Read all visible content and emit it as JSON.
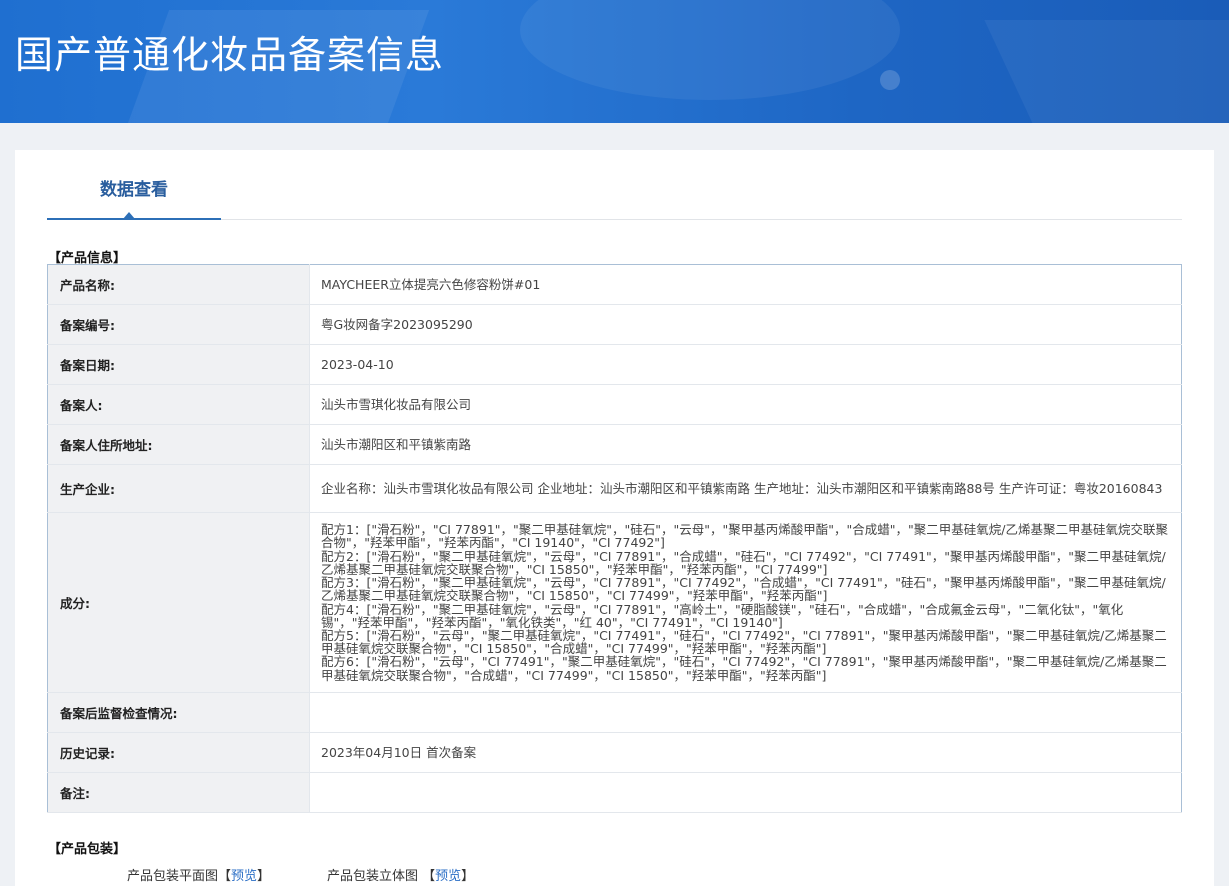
{
  "header": {
    "title": "国产普通化妆品备案信息"
  },
  "tabs": [
    {
      "label": "数据查看",
      "active": true
    }
  ],
  "product_info": {
    "section_title": "【产品信息】",
    "rows": [
      {
        "label": "产品名称:",
        "value": "MAYCHEER立体提亮六色修容粉饼#01"
      },
      {
        "label": "备案编号:",
        "value": "粤G妆网备字2023095290"
      },
      {
        "label": "备案日期:",
        "value": "2023-04-10"
      },
      {
        "label": "备案人:",
        "value": "汕头市雪琪化妆品有限公司"
      },
      {
        "label": "备案人住所地址:",
        "value": "汕头市潮阳区和平镇紫南路"
      },
      {
        "label": "生产企业:",
        "value": "企业名称：汕头市雪琪化妆品有限公司 企业地址：汕头市潮阳区和平镇紫南路 生产地址：汕头市潮阳区和平镇紫南路88号 生产许可证：粤妆20160843"
      },
      {
        "label": "成分:",
        "formulas": [
          "配方1：[\"滑石粉\"，\"CI 77891\"，\"聚二甲基硅氧烷\"，\"硅石\"，\"云母\"，\"聚甲基丙烯酸甲酯\"，\"合成蜡\"，\"聚二甲基硅氧烷/乙烯基聚二甲基硅氧烷交联聚合物\"，\"羟苯甲酯\"，\"羟苯丙酯\"，\"CI 19140\"，\"CI 77492\"]",
          "配方2：[\"滑石粉\"，\"聚二甲基硅氧烷\"，\"云母\"，\"CI 77891\"，\"合成蜡\"，\"硅石\"，\"CI 77492\"，\"CI 77491\"，\"聚甲基丙烯酸甲酯\"，\"聚二甲基硅氧烷/乙烯基聚二甲基硅氧烷交联聚合物\"，\"CI 15850\"，\"羟苯甲酯\"，\"羟苯丙酯\"，\"CI 77499\"]",
          "配方3：[\"滑石粉\"，\"聚二甲基硅氧烷\"，\"云母\"，\"CI 77891\"，\"CI 77492\"，\"合成蜡\"，\"CI 77491\"，\"硅石\"，\"聚甲基丙烯酸甲酯\"，\"聚二甲基硅氧烷/乙烯基聚二甲基硅氧烷交联聚合物\"，\"CI 15850\"，\"CI 77499\"，\"羟苯甲酯\"，\"羟苯丙酯\"]",
          "配方4：[\"滑石粉\"，\"聚二甲基硅氧烷\"，\"云母\"，\"CI 77891\"，\"高岭土\"，\"硬脂酸镁\"，\"硅石\"，\"合成蜡\"，\"合成氟金云母\"，\"二氧化钛\"，\"氧化锡\"，\"羟苯甲酯\"，\"羟苯丙酯\"，\"氧化铁类\"，\"红 40\"，\"CI 77491\"，\"CI 19140\"]",
          "配方5：[\"滑石粉\"，\"云母\"，\"聚二甲基硅氧烷\"，\"CI 77491\"，\"硅石\"，\"CI 77492\"，\"CI 77891\"，\"聚甲基丙烯酸甲酯\"，\"聚二甲基硅氧烷/乙烯基聚二甲基硅氧烷交联聚合物\"，\"CI 15850\"，\"合成蜡\"，\"CI 77499\"，\"羟苯甲酯\"，\"羟苯丙酯\"]",
          "配方6：[\"滑石粉\"，\"云母\"，\"CI 77491\"，\"聚二甲基硅氧烷\"，\"硅石\"，\"CI 77492\"，\"CI 77891\"，\"聚甲基丙烯酸甲酯\"，\"聚二甲基硅氧烷/乙烯基聚二甲基硅氧烷交联聚合物\"，\"合成蜡\"，\"CI 77499\"，\"CI 15850\"，\"羟苯甲酯\"，\"羟苯丙酯\"]"
        ]
      },
      {
        "label": "备案后监督检查情况:",
        "value": ""
      },
      {
        "label": "历史记录:",
        "value": "2023年04月10日 首次备案"
      },
      {
        "label": "备注:",
        "value": ""
      }
    ]
  },
  "packaging": {
    "section_title": "【产品包装】",
    "items": [
      {
        "label": "产品包装平面图",
        "link_open": "【",
        "link_text": "预览",
        "link_close": "】"
      },
      {
        "label": "产品包装立体图 ",
        "link_open": "【",
        "link_text": "预览",
        "link_close": "】"
      }
    ]
  },
  "colors": {
    "banner": "#1f6fd0",
    "accent": "#2c6fb7",
    "link": "#2a6ec6"
  }
}
